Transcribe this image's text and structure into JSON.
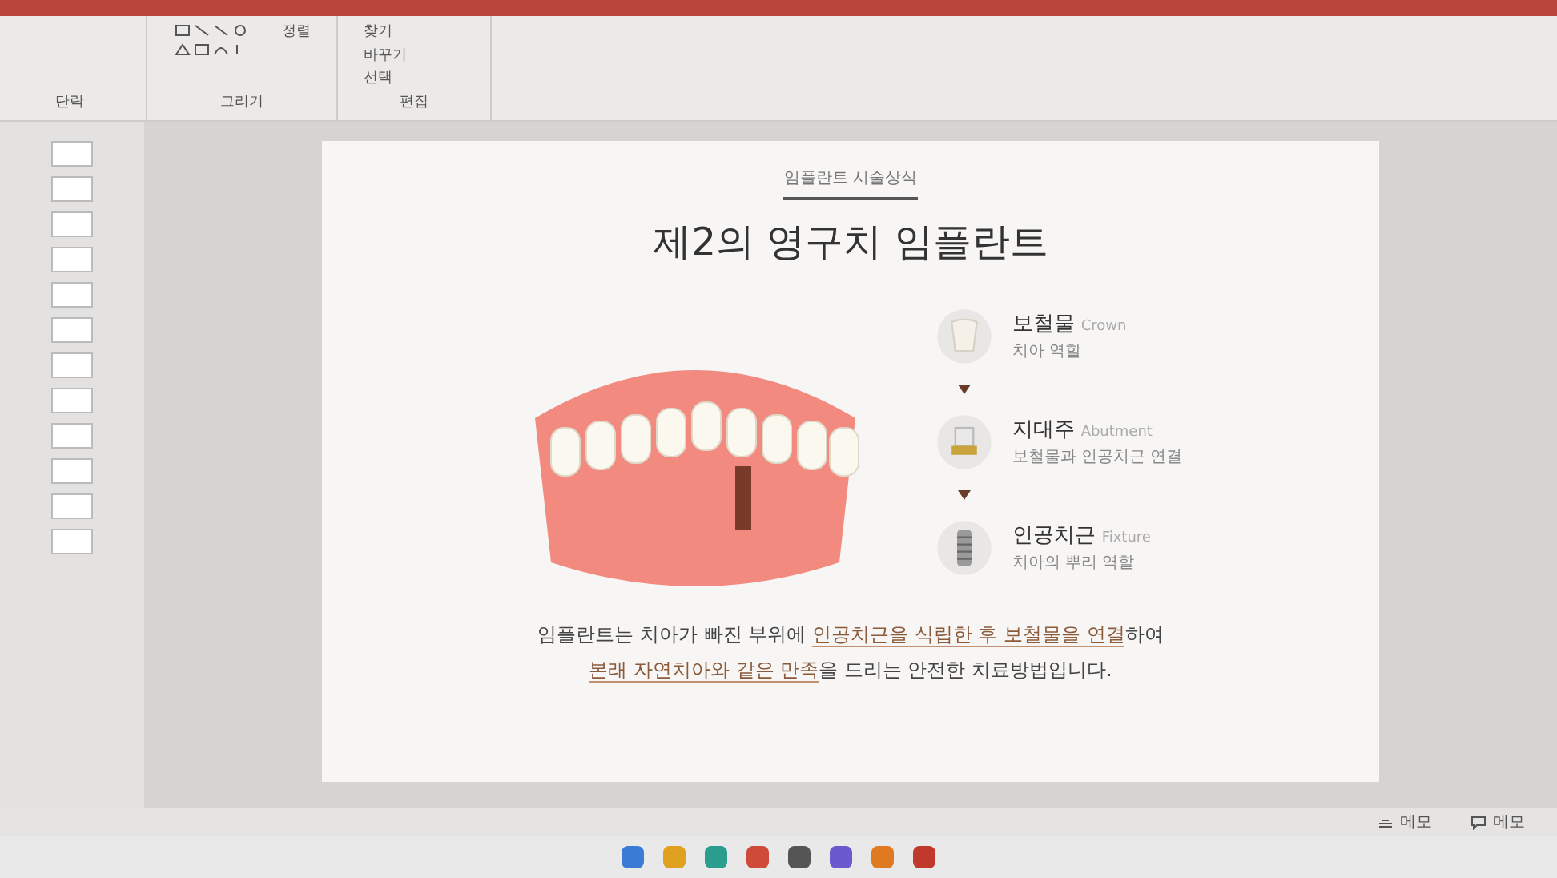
{
  "ribbon": {
    "groups": [
      {
        "label": "단락"
      },
      {
        "label": "그리기",
        "arrange": "정렬"
      },
      {
        "label": "편집",
        "items": [
          "찾기",
          "바꾸기",
          "선택"
        ]
      }
    ]
  },
  "slide": {
    "subtitle": "임플란트 시술상식",
    "title": "제2의 영구치 임플란트",
    "parts": [
      {
        "kind": "crown",
        "name": "보철물",
        "english": "Crown",
        "desc": "치아 역할"
      },
      {
        "kind": "abutment",
        "name": "지대주",
        "english": "Abutment",
        "desc": "보철물과 인공치근 연결"
      },
      {
        "kind": "fixture",
        "name": "인공치근",
        "english": "Fixture",
        "desc": "치아의 뿌리 역할"
      }
    ],
    "description": [
      [
        {
          "text": "임플란트는 치아가 빠진 부위에 ",
          "underlined": false
        },
        {
          "text": "인공치근을 식립한 후 보철물을 연결",
          "underlined": true
        },
        {
          "text": "하여",
          "underlined": false
        }
      ],
      [
        {
          "text": "본래 자연치아와 같은 만족",
          "underlined": true
        },
        {
          "text": "을 드리는 안전한 치료방법입니다.",
          "underlined": false
        }
      ]
    ]
  },
  "status_bar": {
    "buttons": [
      {
        "kind": "notes",
        "label": "메모"
      },
      {
        "kind": "comments",
        "label": "메모"
      }
    ]
  }
}
